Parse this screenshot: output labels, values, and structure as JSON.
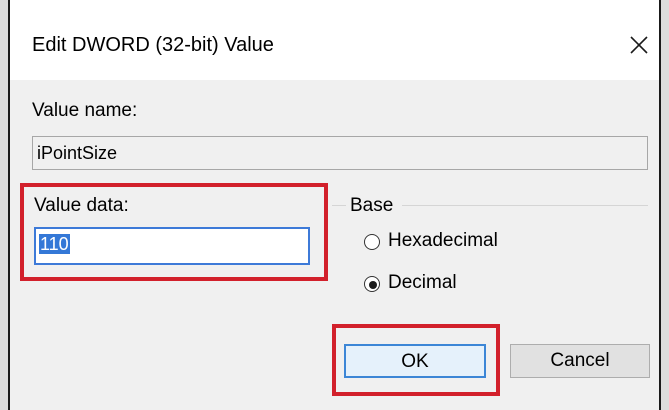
{
  "dialog": {
    "title": "Edit DWORD (32-bit) Value",
    "close_icon": "close-icon"
  },
  "value_name": {
    "label": "Value name:",
    "value": "iPointSize"
  },
  "value_data": {
    "label": "Value data:",
    "value": "110",
    "selected": true
  },
  "base": {
    "label": "Base",
    "options": [
      {
        "label": "Hexadecimal",
        "selected": false
      },
      {
        "label": "Decimal",
        "selected": true
      }
    ]
  },
  "buttons": {
    "ok": "OK",
    "cancel": "Cancel"
  },
  "annotation": {
    "highlight_color": "#d2202b",
    "highlighted": [
      "value-data-field",
      "ok-button"
    ]
  }
}
